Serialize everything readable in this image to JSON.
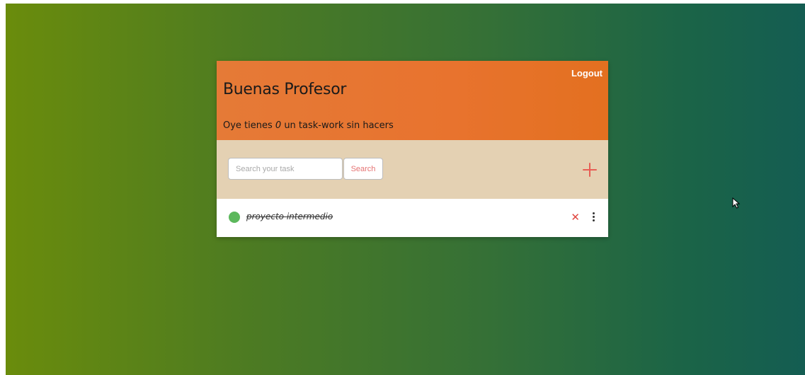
{
  "header": {
    "logout_label": "Logout",
    "greeting": "Buenas Profesor",
    "summary_prefix": "Oye tienes ",
    "pending_count": "0",
    "summary_suffix": " un task-work sin hacers"
  },
  "toolbar": {
    "search_placeholder": "Search your task",
    "search_value": "",
    "search_button_label": "Search",
    "add_icon": "plus-icon"
  },
  "tasks": [
    {
      "name": "proyecto intermedio",
      "completed": true,
      "status_color": "#5cb85c",
      "delete_glyph": "✕"
    }
  ],
  "colors": {
    "header_accent": "#e8732e",
    "toolbar_bg": "#e4d1b3",
    "add_accent": "#e75e55",
    "search_text": "#e57373",
    "status_done": "#5cb85c"
  }
}
